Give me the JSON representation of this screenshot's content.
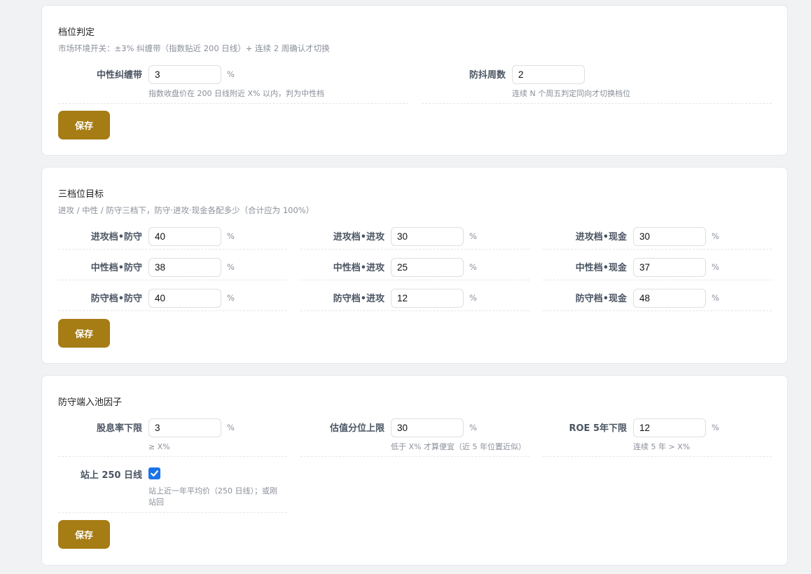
{
  "sections": {
    "tier": {
      "title": "档位判定",
      "subtitle": "市场环境开关：±3% 纠缠带（指数贴近 200 日线）+ 连续 2 周确认才切换",
      "band": {
        "label": "中性纠缠带",
        "value": "3",
        "unit": "%",
        "hint": "指数收盘价在 200 日线附近 X% 以内，判为中性档"
      },
      "weeks": {
        "label": "防抖周数",
        "value": "2",
        "hint": "连续 N 个周五判定同向才切换档位"
      },
      "save_label": "保存"
    },
    "targets": {
      "title": "三档位目标",
      "subtitle": "进攻 / 中性 / 防守三档下，防守·进攻·现金各配多少（合计应为 100%）",
      "unit": "%",
      "rows": [
        [
          {
            "label": "进攻档•防守",
            "value": "40"
          },
          {
            "label": "进攻档•进攻",
            "value": "30"
          },
          {
            "label": "进攻档•现金",
            "value": "30"
          }
        ],
        [
          {
            "label": "中性档•防守",
            "value": "38"
          },
          {
            "label": "中性档•进攻",
            "value": "25"
          },
          {
            "label": "中性档•现金",
            "value": "37"
          }
        ],
        [
          {
            "label": "防守档•防守",
            "value": "40"
          },
          {
            "label": "防守档•进攻",
            "value": "12"
          },
          {
            "label": "防守档•现金",
            "value": "48"
          }
        ]
      ],
      "save_label": "保存"
    },
    "factors": {
      "title": "防守端入池因子",
      "dividend": {
        "label": "股息率下限",
        "value": "3",
        "unit": "%",
        "hint": "≥ X%"
      },
      "valuation": {
        "label": "估值分位上限",
        "value": "30",
        "unit": "%",
        "hint": "低于 X% 才算便宜（近 5 年位置近似）"
      },
      "roe": {
        "label": "ROE 5年下限",
        "value": "12",
        "unit": "%",
        "hint": "连续 5 年 > X%"
      },
      "ma250": {
        "label": "站上 250 日线",
        "checked": true,
        "hint_line1": "站上近一年平均价（250 日线）；或刚",
        "hint_line2": "站回"
      },
      "save_label": "保存"
    }
  },
  "colors": {
    "accent": "#a67c14",
    "checkbox": "#1a73e8",
    "muted": "#8a8f99"
  },
  "icons": {
    "check": "checkmark-icon"
  }
}
